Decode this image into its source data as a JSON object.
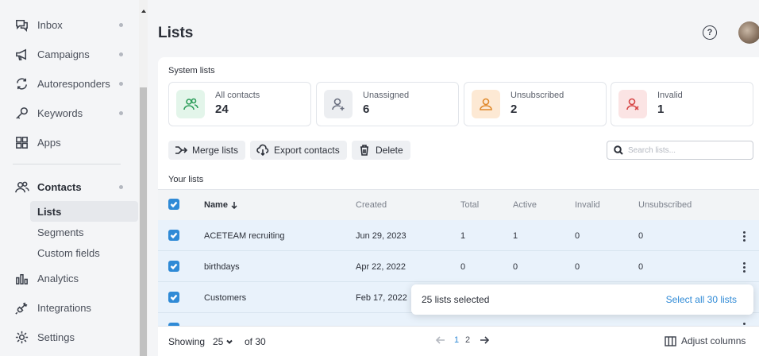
{
  "sidebar": {
    "items": [
      {
        "label": "Inbox",
        "icon": "chat-bubbles-icon",
        "has_dot": true
      },
      {
        "label": "Campaigns",
        "icon": "megaphone-icon",
        "has_dot": true
      },
      {
        "label": "Autoresponders",
        "icon": "refresh-arrows-icon",
        "has_dot": true
      },
      {
        "label": "Keywords",
        "icon": "key-icon",
        "has_dot": true
      },
      {
        "label": "Apps",
        "icon": "grid-icon",
        "has_dot": false
      },
      {
        "label": "Contacts",
        "icon": "contacts-icon",
        "has_dot": true
      },
      {
        "label": "Analytics",
        "icon": "bar-chart-icon",
        "has_dot": false
      },
      {
        "label": "Integrations",
        "icon": "plug-icon",
        "has_dot": false
      },
      {
        "label": "Settings",
        "icon": "gear-icon",
        "has_dot": false
      }
    ],
    "contacts_subitems": [
      {
        "label": "Lists",
        "active": true
      },
      {
        "label": "Segments",
        "active": false
      },
      {
        "label": "Custom fields",
        "active": false
      }
    ]
  },
  "header": {
    "title": "Lists",
    "help_glyph": "?"
  },
  "system_lists": {
    "label": "System lists",
    "tiles": [
      {
        "label": "All contacts",
        "count": "24",
        "icon": "contacts-icon",
        "accent": "#2e9e5b",
        "bg": "#e3f5ea"
      },
      {
        "label": "Unassigned",
        "count": "6",
        "icon": "user-plus-icon",
        "accent": "#6b7080",
        "bg": "#eceef1"
      },
      {
        "label": "Unsubscribed",
        "count": "2",
        "icon": "user-icon",
        "accent": "#e0892b",
        "bg": "#fde9d4"
      },
      {
        "label": "Invalid",
        "count": "1",
        "icon": "user-x-icon",
        "accent": "#d64545",
        "bg": "#fbe4e4"
      }
    ]
  },
  "actions": {
    "merge": "Merge lists",
    "export": "Export contacts",
    "delete": "Delete"
  },
  "search": {
    "placeholder": "Search lists..."
  },
  "your_lists_label": "Your lists",
  "table": {
    "columns": {
      "name": "Name",
      "created": "Created",
      "total": "Total",
      "active": "Active",
      "invalid": "Invalid",
      "unsubscribed": "Unsubscribed"
    },
    "rows": [
      {
        "name": "ACETEAM recruiting",
        "created": "Jun 29, 2023",
        "total": "1",
        "active": "1",
        "invalid": "0",
        "unsubscribed": "0"
      },
      {
        "name": "birthdays",
        "created": "Apr 22, 2022",
        "total": "0",
        "active": "0",
        "invalid": "0",
        "unsubscribed": "0"
      },
      {
        "name": "Customers",
        "created": "Feb 17, 2022",
        "total": "",
        "active": "",
        "invalid": "",
        "unsubscribed": ""
      }
    ]
  },
  "selection": {
    "count_text": "25 lists selected",
    "select_all_text": "Select all 30 lists"
  },
  "footer": {
    "showing": "Showing",
    "per_page": "25",
    "of_total": "of 30",
    "pages": [
      "1",
      "2"
    ],
    "current_page": "1",
    "adjust_columns": "Adjust columns"
  },
  "colors": {
    "accent_blue": "#2f8ad6",
    "row_selected_bg": "#e9f2fb"
  }
}
